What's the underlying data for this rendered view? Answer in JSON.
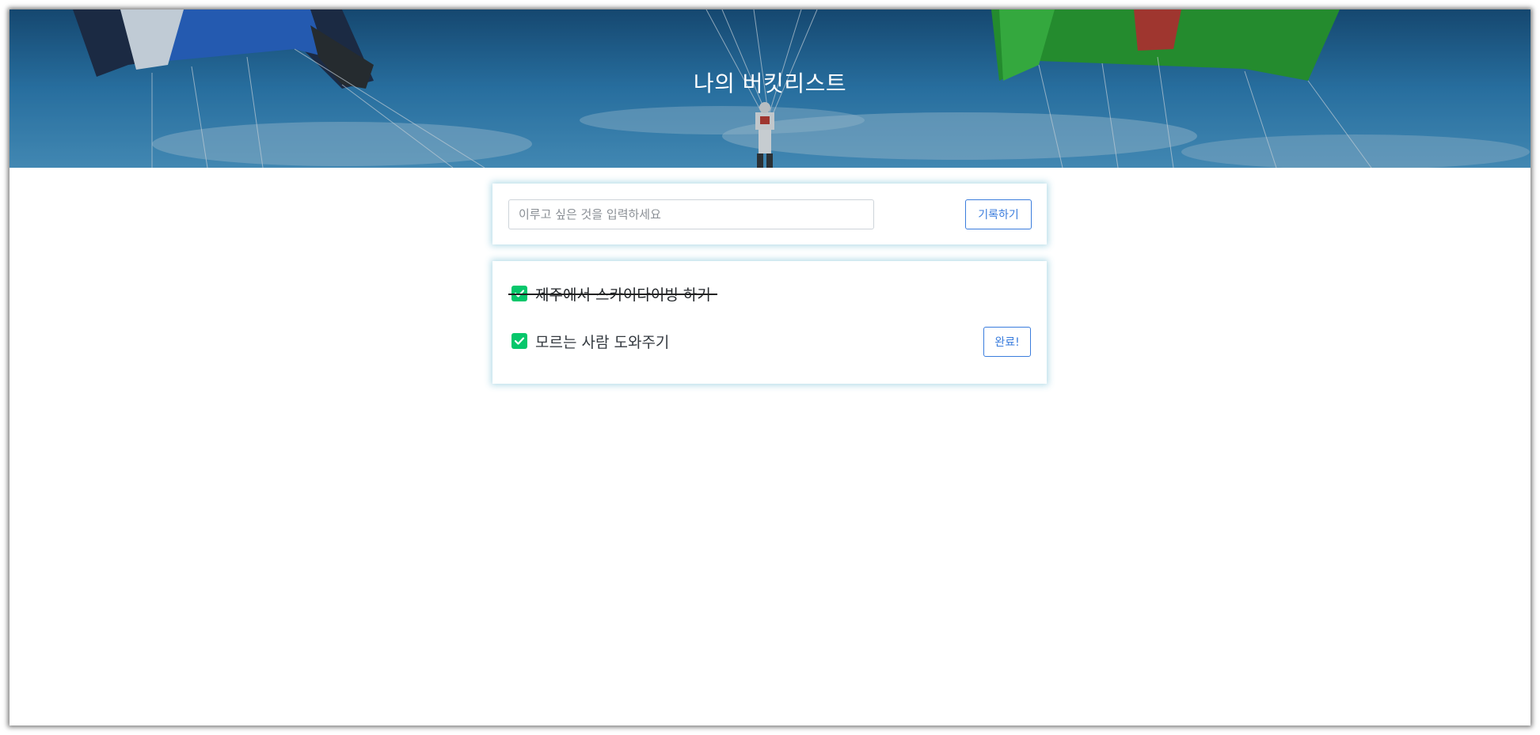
{
  "header": {
    "title": "나의 버킷리스트"
  },
  "input_card": {
    "placeholder": "이루고 싶은 것을 입력하세요",
    "value": "",
    "save_label": "기록하기"
  },
  "bucket_list": {
    "items": [
      {
        "text": "제주에서 스카이다이빙 하기",
        "done": true
      },
      {
        "text": "모르는 사람 도와주기",
        "done": false,
        "action_label": "완료!"
      }
    ]
  },
  "colors": {
    "accent": "#3b7ddd",
    "check": "#06c76b",
    "card_glow": "#add8e6"
  },
  "icons": {
    "checkbox": "check-icon"
  }
}
